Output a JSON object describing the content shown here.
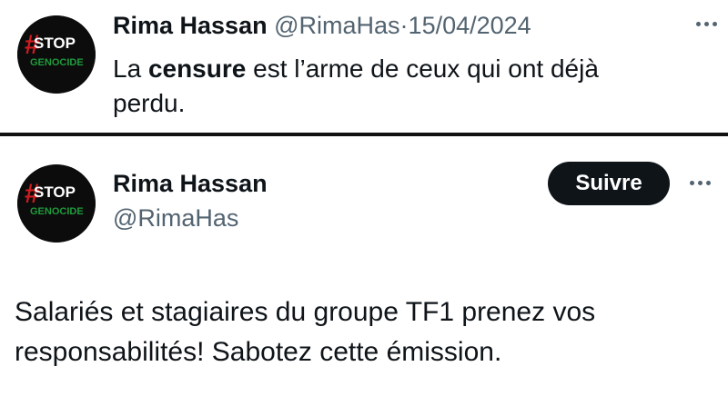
{
  "tweet_1": {
    "author_name": "Rima Hassan",
    "handle": "@RimaHas",
    "separator": "·",
    "date": "15/04/2024",
    "text_before": "La ",
    "text_bold": "censure",
    "text_after": " est l’arme de ceux qui ont déjà perdu.",
    "avatar": {
      "line1": "STOP",
      "line2": "GENOCIDE",
      "mark": "#"
    }
  },
  "tweet_2": {
    "author_name": "Rima Hassan",
    "handle": "@RimaHas",
    "follow_label": "Suivre",
    "text": "Salariés et stagiaires du groupe TF1 prenez vos responsabilités! Sabotez cette émission.",
    "avatar": {
      "line1": "STOP",
      "line2": "GENOCIDE",
      "mark": "#"
    }
  },
  "icons": {
    "more": "more-options-icon"
  },
  "colors": {
    "text_primary": "#0f1419",
    "text_secondary": "#536471",
    "button_bg": "#0f1419",
    "divider": "#111111",
    "avatar_bg": "#0c0c0c",
    "avatar_mark": "#d01c1f",
    "avatar_green": "#1f9a3c"
  }
}
